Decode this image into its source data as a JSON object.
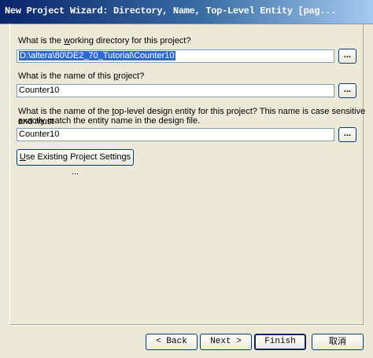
{
  "window": {
    "title": "New Project Wizard: Directory, Name, Top-Level Entity [pag..."
  },
  "dir": {
    "label_pre": "What is the ",
    "label_ul": "w",
    "label_post": "orking directory for this project?",
    "value": "D:\\altera\\80\\DE2_70_Tutorial\\Counter10",
    "browse_label": "..."
  },
  "name": {
    "label_pre": "What is the name of this ",
    "label_ul": "p",
    "label_post": "roject?",
    "value": "Counter10",
    "browse_label": "..."
  },
  "entity": {
    "label_pre": "What is the name of the ",
    "label_ul": "t",
    "label_post": "op-level design entity for this project? This name is case sensitive and must",
    "label_line2": "exactly match the entity name in the design file.",
    "value": "Counter10",
    "browse_label": "..."
  },
  "existing": {
    "label_ul": "U",
    "label_post": "se Existing Project Settings ..."
  },
  "footer": {
    "back": "< Back",
    "next": "Next >",
    "finish": "Finish",
    "cancel": "取消"
  }
}
